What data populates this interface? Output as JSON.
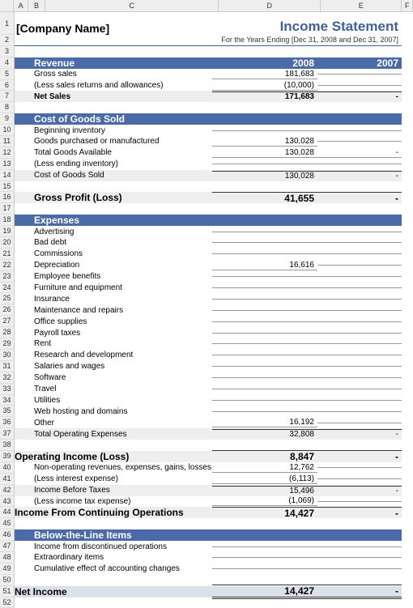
{
  "columns": [
    "A",
    "B",
    "C",
    "D",
    "E",
    "F"
  ],
  "title": {
    "company": "[Company Name]",
    "doc": "Income Statement"
  },
  "subtitle": "For the Years Ending [Dec 31, 2008 and Dec 31, 2007]",
  "years": {
    "y1": "2008",
    "y2": "2007"
  },
  "revenue": {
    "header": "Revenue",
    "gross_sales": {
      "label": "Gross sales",
      "v1": "181,683",
      "v2": ""
    },
    "less_returns": {
      "label": "(Less sales returns and allowances)",
      "v1": "(10,000)",
      "v2": ""
    },
    "net_sales": {
      "label": "Net Sales",
      "v1": "171,683",
      "v2": "-"
    }
  },
  "cogs": {
    "header": "Cost of Goods Sold",
    "beginning": {
      "label": "Beginning inventory",
      "v1": "",
      "v2": ""
    },
    "purchased": {
      "label": "Goods purchased or manufactured",
      "v1": "130,028",
      "v2": ""
    },
    "total_avail": {
      "label": "Total Goods Available",
      "v1": "130,028",
      "v2": "-"
    },
    "less_ending": {
      "label": "(Less ending inventory)",
      "v1": "",
      "v2": ""
    },
    "cost_sold": {
      "label": "Cost of Goods Sold",
      "v1": "130,028",
      "v2": "-"
    },
    "gross_profit": {
      "label": "Gross Profit (Loss)",
      "v1": "41,655",
      "v2": "-"
    }
  },
  "expenses": {
    "header": "Expenses",
    "items": [
      {
        "label": "Advertising",
        "v1": "",
        "v2": ""
      },
      {
        "label": "Bad debt",
        "v1": "",
        "v2": ""
      },
      {
        "label": "Commissions",
        "v1": "",
        "v2": ""
      },
      {
        "label": "Depreciation",
        "v1": "16,616",
        "v2": ""
      },
      {
        "label": "Employee benefits",
        "v1": "",
        "v2": ""
      },
      {
        "label": "Furniture and equipment",
        "v1": "",
        "v2": ""
      },
      {
        "label": "Insurance",
        "v1": "",
        "v2": ""
      },
      {
        "label": "Maintenance and repairs",
        "v1": "",
        "v2": ""
      },
      {
        "label": "Office supplies",
        "v1": "",
        "v2": ""
      },
      {
        "label": "Payroll taxes",
        "v1": "",
        "v2": ""
      },
      {
        "label": "Rent",
        "v1": "",
        "v2": ""
      },
      {
        "label": "Research and development",
        "v1": "",
        "v2": ""
      },
      {
        "label": "Salaries and wages",
        "v1": "",
        "v2": ""
      },
      {
        "label": "Software",
        "v1": "",
        "v2": ""
      },
      {
        "label": "Travel",
        "v1": "",
        "v2": ""
      },
      {
        "label": "Utilities",
        "v1": "",
        "v2": ""
      },
      {
        "label": "Web hosting and domains",
        "v1": "",
        "v2": ""
      },
      {
        "label": "Other",
        "v1": "16,192",
        "v2": ""
      }
    ],
    "total": {
      "label": "Total Operating Expenses",
      "v1": "32,808",
      "v2": "-"
    }
  },
  "operating": {
    "title": {
      "label": "Operating Income (Loss)",
      "v1": "8,847",
      "v2": "-"
    },
    "nonop": {
      "label": "Non-operating revenues, expenses, gains, losses",
      "v1": "12,762",
      "v2": ""
    },
    "less_interest": {
      "label": "(Less interest expense)",
      "v1": "(6,113)",
      "v2": ""
    },
    "before_tax": {
      "label": "Income Before Taxes",
      "v1": "15,496",
      "v2": "-"
    },
    "less_tax": {
      "label": "(Less income tax expense)",
      "v1": "(1,069)",
      "v2": ""
    },
    "continuing": {
      "label": "Income From Continuing Operations",
      "v1": "14,427",
      "v2": "-"
    }
  },
  "below": {
    "header": "Below-the-Line Items",
    "discontinued": {
      "label": "Income from discontinued operations",
      "v1": "",
      "v2": ""
    },
    "extraordinary": {
      "label": "Extraordinary items",
      "v1": "",
      "v2": ""
    },
    "cumulative": {
      "label": "Cumulative effect of accounting changes",
      "v1": "",
      "v2": ""
    }
  },
  "net_income": {
    "label": "Net Income",
    "v1": "14,427",
    "v2": "-"
  }
}
